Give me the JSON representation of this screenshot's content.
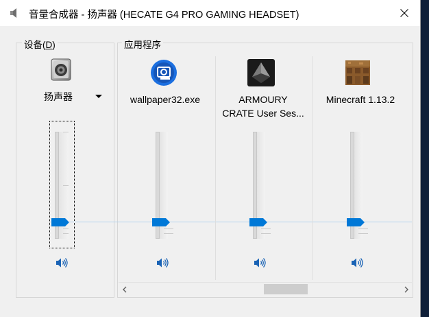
{
  "window": {
    "title": "音量合成器 - 扬声器 (HECATE G4 PRO GAMING HEADSET)"
  },
  "device_group": {
    "label": "设备(",
    "label_mnemonic": "D",
    "label_close": ")",
    "device_name": "扬声器",
    "volume_percent": 20
  },
  "apps_group": {
    "label": "应用程序"
  },
  "apps": [
    {
      "name_line1": "wallpaper32.exe",
      "name_line2": "",
      "icon": "wallpaper-engine-icon",
      "volume_percent": 20
    },
    {
      "name_line1": "ARMOURY",
      "name_line2": "CRATE User Ses...",
      "icon": "armoury-crate-icon",
      "volume_percent": 20
    },
    {
      "name_line1": "Minecraft 1.13.2",
      "name_line2": "",
      "icon": "minecraft-icon",
      "volume_percent": 20
    }
  ],
  "colors": {
    "accent": "#0078d7",
    "speaker_icon": "#1a63b5"
  }
}
